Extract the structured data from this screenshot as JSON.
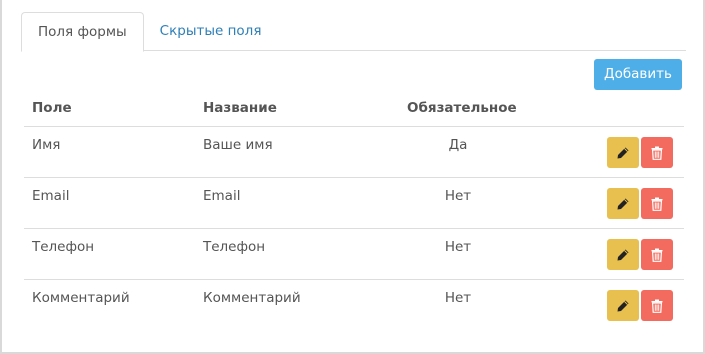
{
  "tabs": [
    {
      "label": "Поля формы",
      "active": true
    },
    {
      "label": "Скрытые поля",
      "active": false
    }
  ],
  "add_button_label": "Добавить",
  "table": {
    "headers": {
      "field": "Поле",
      "name": "Название",
      "required": "Обязательное"
    },
    "rows": [
      {
        "field": "Имя",
        "name": "Ваше имя",
        "required": "Да"
      },
      {
        "field": "Email",
        "name": "Email",
        "required": "Нет"
      },
      {
        "field": "Телефон",
        "name": "Телефон",
        "required": "Нет"
      },
      {
        "field": "Комментарий",
        "name": "Комментарий",
        "required": "Нет"
      }
    ]
  },
  "icons": {
    "edit": "pencil-icon",
    "delete": "trash-icon"
  },
  "colors": {
    "primary": "#4eaee8",
    "edit": "#e8c050",
    "delete": "#f26b5e",
    "tab_link": "#2d7fb8"
  }
}
